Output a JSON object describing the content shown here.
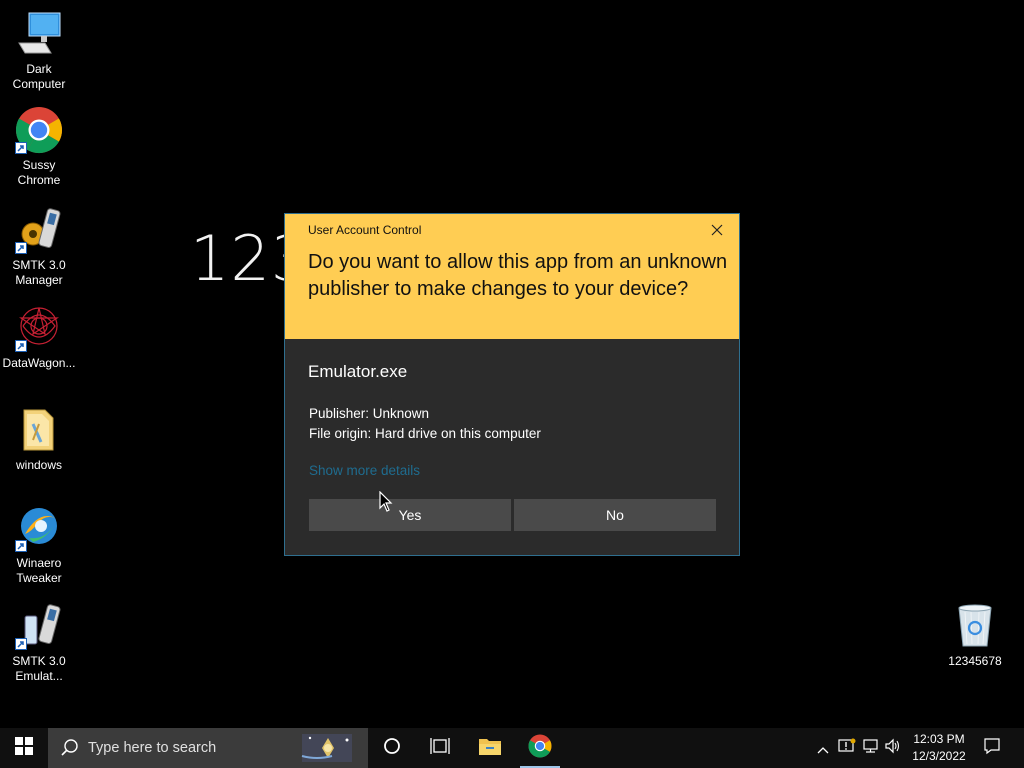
{
  "desktop": {
    "icons": [
      {
        "label_1": "Dark",
        "label_2": "Computer",
        "icon": "computer-icon"
      },
      {
        "label_1": "Sussy",
        "label_2": "Chrome",
        "icon": "chrome-icon"
      },
      {
        "label_1": "SMTK 3.0",
        "label_2": "Manager",
        "icon": "smtk-manager-icon"
      },
      {
        "label_1": "DataWagon...",
        "label_2": "",
        "icon": "datawagon-icon"
      },
      {
        "label_1": "windows",
        "label_2": "",
        "icon": "folder-icon"
      },
      {
        "label_1": "Winaero",
        "label_2": "Tweaker",
        "icon": "winaero-icon"
      },
      {
        "label_1": "SMTK 3.0",
        "label_2": "Emulat...",
        "icon": "smtk-emulator-icon"
      }
    ],
    "recycle_bin": {
      "label": "12345678",
      "icon": "recycle-bin-icon"
    },
    "background_text": "123"
  },
  "uac": {
    "caption": "User Account Control",
    "question": "Do you want to allow this app from an unknown publisher to make changes to your device?",
    "app_name": "Emulator.exe",
    "publisher": "Publisher: Unknown",
    "file_origin": "File origin: Hard drive on this computer",
    "show_details": "Show more details",
    "yes_label": "Yes",
    "no_label": "No",
    "colors": {
      "header": "#ffcd53",
      "body": "#2b2b2b",
      "button": "#4a4a4a",
      "link": "#1f6c8f"
    }
  },
  "taskbar": {
    "search_placeholder": "Type here to search",
    "clock_time": "12:03 PM",
    "clock_date": "12/3/2022",
    "pinned": [
      "file-explorer-icon",
      "chrome-icon"
    ]
  }
}
